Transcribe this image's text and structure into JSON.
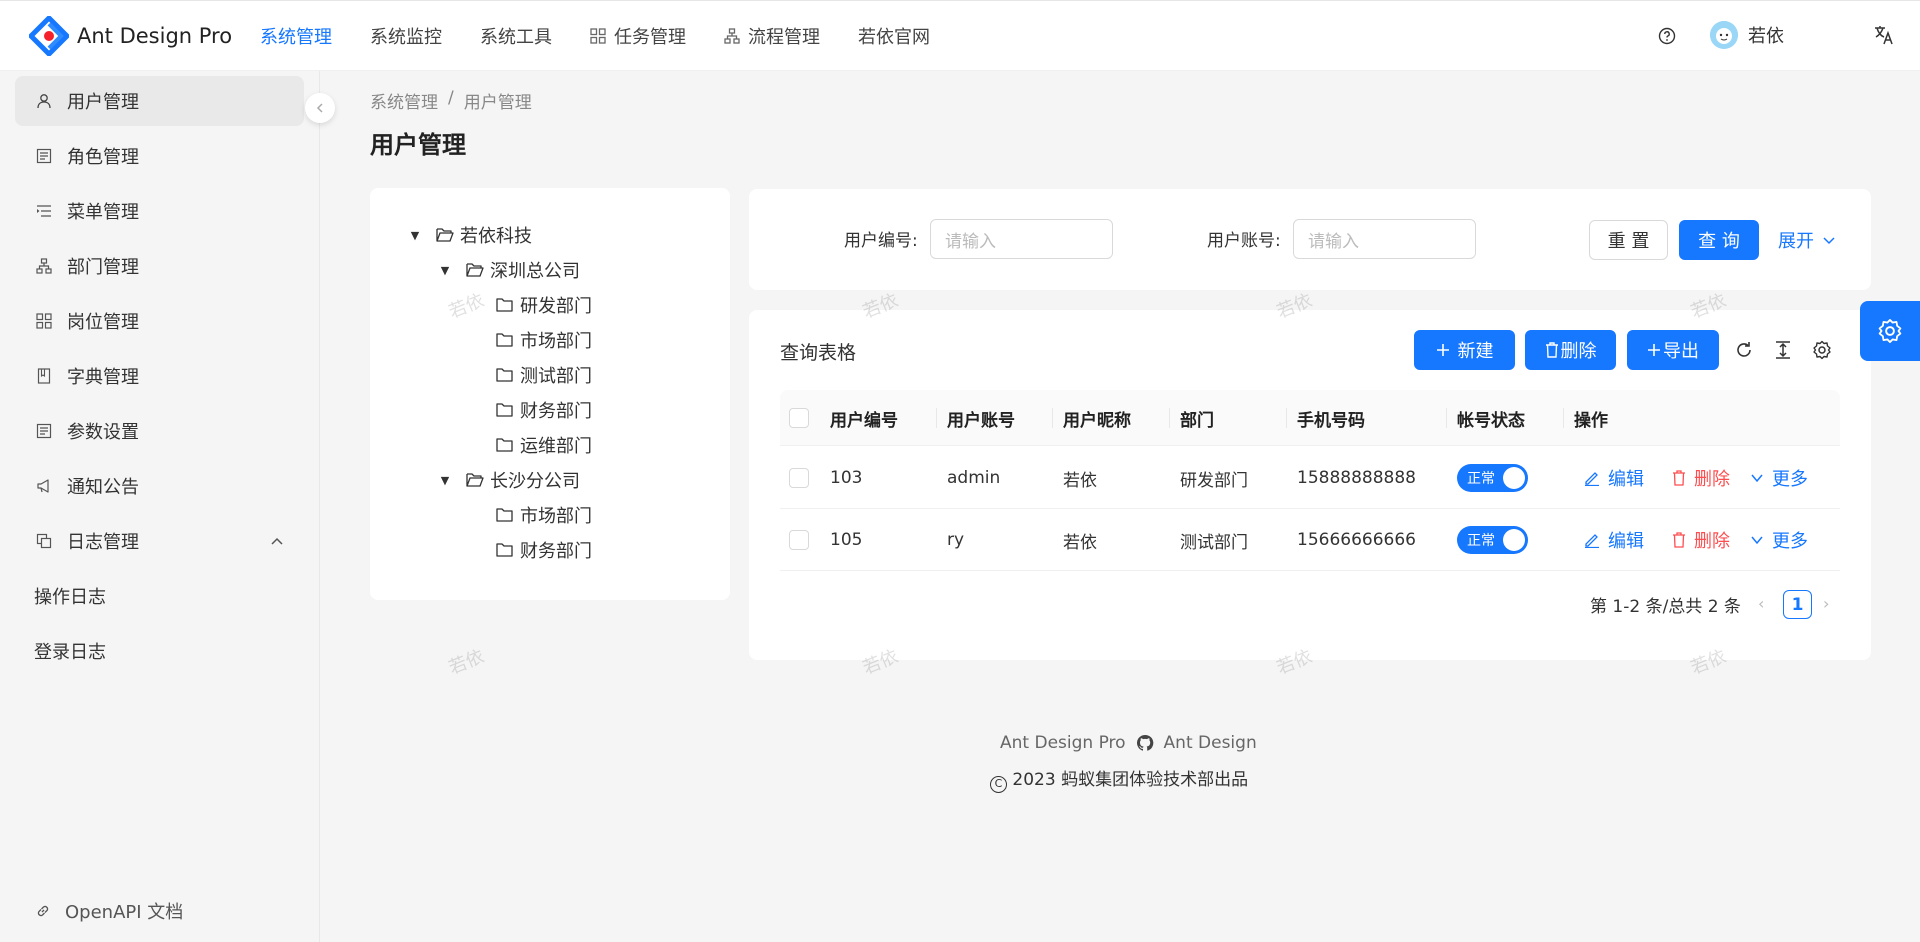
{
  "header": {
    "logo_title": "Ant Design Pro",
    "nav": [
      {
        "label": "系统管理",
        "active": true,
        "icon": ""
      },
      {
        "label": "系统监控",
        "active": false,
        "icon": ""
      },
      {
        "label": "系统工具",
        "active": false,
        "icon": ""
      },
      {
        "label": "任务管理",
        "active": false,
        "icon": "appstore-icon"
      },
      {
        "label": "流程管理",
        "active": false,
        "icon": "cluster-icon"
      },
      {
        "label": "若依官网",
        "active": false,
        "icon": ""
      }
    ],
    "user_name": "若依",
    "lang_icon": "translate-icon"
  },
  "sidebar": {
    "items": [
      {
        "label": "用户管理",
        "icon": "user-icon",
        "active": true
      },
      {
        "label": "角色管理",
        "icon": "profile-icon",
        "active": false
      },
      {
        "label": "菜单管理",
        "icon": "menu-icon",
        "active": false
      },
      {
        "label": "部门管理",
        "icon": "cluster-icon",
        "active": false
      },
      {
        "label": "岗位管理",
        "icon": "appstore-icon",
        "active": false
      },
      {
        "label": "字典管理",
        "icon": "book-icon",
        "active": false
      },
      {
        "label": "参数设置",
        "icon": "profile-icon",
        "active": false
      },
      {
        "label": "通知公告",
        "icon": "notification-icon",
        "active": false
      },
      {
        "label": "日志管理",
        "icon": "log-icon",
        "active": false,
        "expanded": true
      }
    ],
    "sub_items": [
      {
        "label": "操作日志"
      },
      {
        "label": "登录日志"
      }
    ],
    "bottom_link": "OpenAPI 文档"
  },
  "breadcrumb": {
    "items": [
      "系统管理",
      "用户管理"
    ],
    "separator": "/"
  },
  "page_title": "用户管理",
  "tree": [
    {
      "label": "若依科技",
      "level": 0,
      "expanded": true,
      "has_children": true
    },
    {
      "label": "深圳总公司",
      "level": 1,
      "expanded": true,
      "has_children": true
    },
    {
      "label": "研发部门",
      "level": 2,
      "has_children": false
    },
    {
      "label": "市场部门",
      "level": 2,
      "has_children": false
    },
    {
      "label": "测试部门",
      "level": 2,
      "has_children": false
    },
    {
      "label": "财务部门",
      "level": 2,
      "has_children": false
    },
    {
      "label": "运维部门",
      "level": 2,
      "has_children": false
    },
    {
      "label": "长沙分公司",
      "level": 1,
      "expanded": true,
      "has_children": true
    },
    {
      "label": "市场部门",
      "level": 2,
      "has_children": false
    },
    {
      "label": "财务部门",
      "level": 2,
      "has_children": false
    }
  ],
  "search": {
    "fields": [
      {
        "label": "用户编号",
        "colon": ":",
        "placeholder": "请输入"
      },
      {
        "label": "用户账号",
        "colon": ":",
        "placeholder": "请输入"
      }
    ],
    "reset_label": "重 置",
    "query_label": "查 询",
    "expand_label": "展开"
  },
  "table": {
    "title": "查询表格",
    "toolbar": {
      "new_label": "新建",
      "delete_label": "删除",
      "export_label": "导出"
    },
    "columns": [
      "用户编号",
      "用户账号",
      "用户昵称",
      "部门",
      "手机号码",
      "帐号状态",
      "操作"
    ],
    "rows": [
      {
        "id": "103",
        "account": "admin",
        "nickname": "若依",
        "dept": "研发部门",
        "phone": "15888888888",
        "status": "正常"
      },
      {
        "id": "105",
        "account": "ry",
        "nickname": "若依",
        "dept": "测试部门",
        "phone": "15666666666",
        "status": "正常"
      }
    ],
    "actions": {
      "edit": "编辑",
      "delete": "删除",
      "more": "更多"
    },
    "pagination": {
      "summary": "第 1-2 条/总共 2 条",
      "current": "1"
    }
  },
  "watermark_text": "若依",
  "footer": {
    "links": [
      "Ant Design Pro",
      "Ant Design"
    ],
    "copyright": "2023 蚂蚁集团体验技术部出品"
  },
  "colors": {
    "primary": "#1677ff",
    "danger": "#ff4d4f"
  }
}
